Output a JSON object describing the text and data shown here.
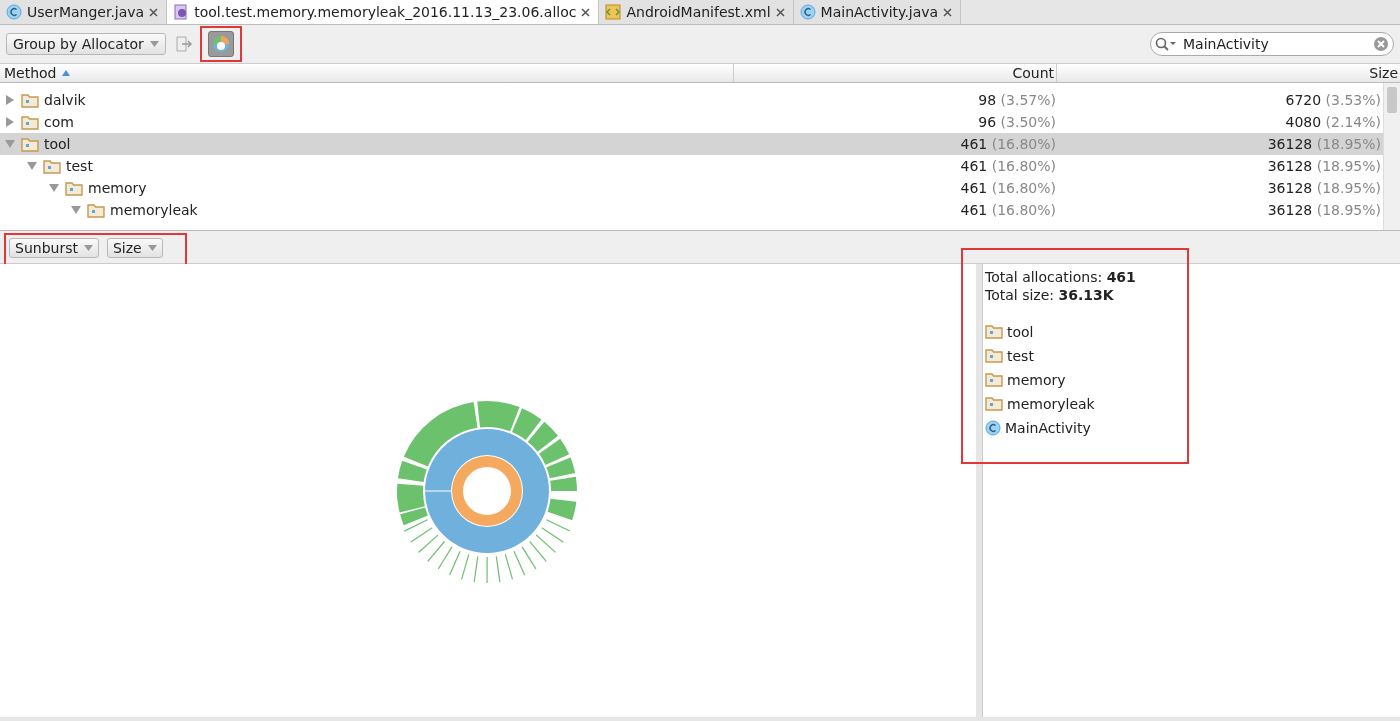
{
  "tabs": [
    {
      "label": "UserManger.java",
      "kind": "class",
      "selected": false
    },
    {
      "label": "tool.test.memory.memoryleak_2016.11.13_23.06.alloc",
      "kind": "alloc",
      "selected": true
    },
    {
      "label": "AndroidManifest.xml",
      "kind": "xml",
      "selected": false
    },
    {
      "label": "MainActivity.java",
      "kind": "class",
      "selected": false
    }
  ],
  "toolbar": {
    "group_by": "Group by Allocator",
    "chart_toggle": {
      "on": true,
      "highlighted": true
    },
    "search": {
      "value": "MainActivity"
    }
  },
  "table": {
    "columns": [
      "Method",
      "Count",
      "Size"
    ],
    "rows": [
      {
        "name": "dalvik",
        "kind": "package",
        "expanded": false,
        "selected": false,
        "count": "98",
        "count_pct": "(3.57%)",
        "size": "6720",
        "size_pct": "(3.53%)"
      },
      {
        "name": "com",
        "kind": "package",
        "expanded": false,
        "selected": false,
        "count": "96",
        "count_pct": "(3.50%)",
        "size": "4080",
        "size_pct": "(2.14%)"
      },
      {
        "name": "tool",
        "kind": "package",
        "expanded": true,
        "selected": true,
        "count": "461",
        "count_pct": "(16.80%)",
        "size": "36128",
        "size_pct": "(18.95%)",
        "children": [
          {
            "name": "test",
            "kind": "package",
            "expanded": true,
            "selected": false,
            "count": "461",
            "count_pct": "(16.80%)",
            "size": "36128",
            "size_pct": "(18.95%)",
            "children": [
              {
                "name": "memory",
                "kind": "package",
                "expanded": true,
                "selected": false,
                "count": "461",
                "count_pct": "(16.80%)",
                "size": "36128",
                "size_pct": "(18.95%)",
                "children": [
                  {
                    "name": "memoryleak",
                    "kind": "package",
                    "expanded": true,
                    "selected": false,
                    "count": "461",
                    "count_pct": "(16.80%)",
                    "size": "36128",
                    "size_pct": "(18.95%)"
                  }
                ]
              }
            ]
          }
        ]
      }
    ]
  },
  "chart_toolbar": {
    "highlighted": true,
    "chart_type": "Sunburst",
    "metric": "Size"
  },
  "details": {
    "highlighted": true,
    "total_allocations": "Total allocations: **461**",
    "total_size": "Total size: **36.13K**",
    "path": [
      {
        "name": "tool",
        "kind": "package"
      },
      {
        "name": "test",
        "kind": "package"
      },
      {
        "name": "memory",
        "kind": "package"
      },
      {
        "name": "memoryleak",
        "kind": "package"
      },
      {
        "name": "MainActivity",
        "kind": "class"
      }
    ]
  }
}
